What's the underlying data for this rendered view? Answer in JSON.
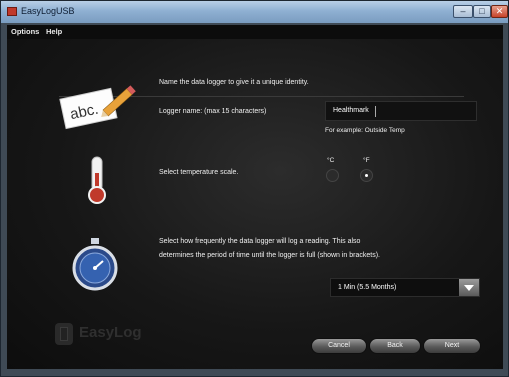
{
  "window": {
    "title": "EasyLogUSB",
    "minimize": "–",
    "maximize": "□",
    "close": "✕"
  },
  "menu": {
    "options": "Options",
    "help": "Help"
  },
  "step_name": {
    "description": "Name the data logger to give it a unique identity.",
    "field_label": "Logger name: (max 15 characters)",
    "value": "Healthmark",
    "example": "For example: Outside Temp",
    "icon": "abc-pencil-icon",
    "icon_text": "abc."
  },
  "step_temperature": {
    "label": "Select temperature scale.",
    "icon": "thermometer-icon",
    "options": [
      {
        "label": "°C",
        "checked": false
      },
      {
        "label": "°F",
        "checked": true
      }
    ]
  },
  "step_rate": {
    "description_line1": "Select how frequently the data logger will log a reading. This also",
    "description_line2": "determines the period of time until the logger is full (shown in brackets).",
    "icon": "stopwatch-icon",
    "selected": "1 Min (5.5 Months)"
  },
  "footer": {
    "cancel": "Cancel",
    "back": "Back",
    "next": "Next",
    "logo": "EasyLog"
  }
}
